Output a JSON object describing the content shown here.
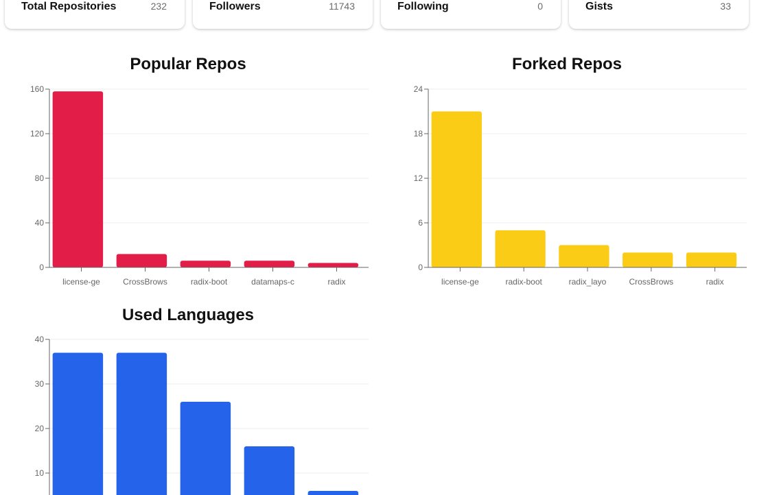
{
  "stats": [
    {
      "label": "Total Repositories",
      "value": "232"
    },
    {
      "label": "Followers",
      "value": "11743"
    },
    {
      "label": "Following",
      "value": "0"
    },
    {
      "label": "Gists",
      "value": "33"
    }
  ],
  "colors": {
    "popular": "#e11d48",
    "forked": "#facc15",
    "languages": "#2563eb"
  },
  "chart_data": [
    {
      "type": "bar",
      "title": "Popular Repos",
      "categories": [
        "license-ge",
        "CrossBrows",
        "radix-boot",
        "datamaps-c",
        "radix"
      ],
      "values": [
        158,
        12,
        6,
        6,
        4
      ],
      "yticks": [
        0,
        40,
        80,
        120,
        160
      ],
      "ylim": [
        0,
        160
      ],
      "grid": true
    },
    {
      "type": "bar",
      "title": "Forked Repos",
      "categories": [
        "license-ge",
        "radix-boot",
        "radix_layo",
        "CrossBrows",
        "radix"
      ],
      "values": [
        21,
        5,
        3,
        2,
        2
      ],
      "yticks": [
        0,
        6,
        12,
        18,
        24
      ],
      "ylim": [
        0,
        24
      ],
      "grid": true
    },
    {
      "type": "bar",
      "title": "Used Languages",
      "categories": [
        "",
        "",
        "",
        "",
        ""
      ],
      "values": [
        37,
        37,
        26,
        16,
        6
      ],
      "yticks": [
        10,
        20,
        30,
        40
      ],
      "ylim": [
        0,
        40
      ],
      "grid": true
    }
  ]
}
